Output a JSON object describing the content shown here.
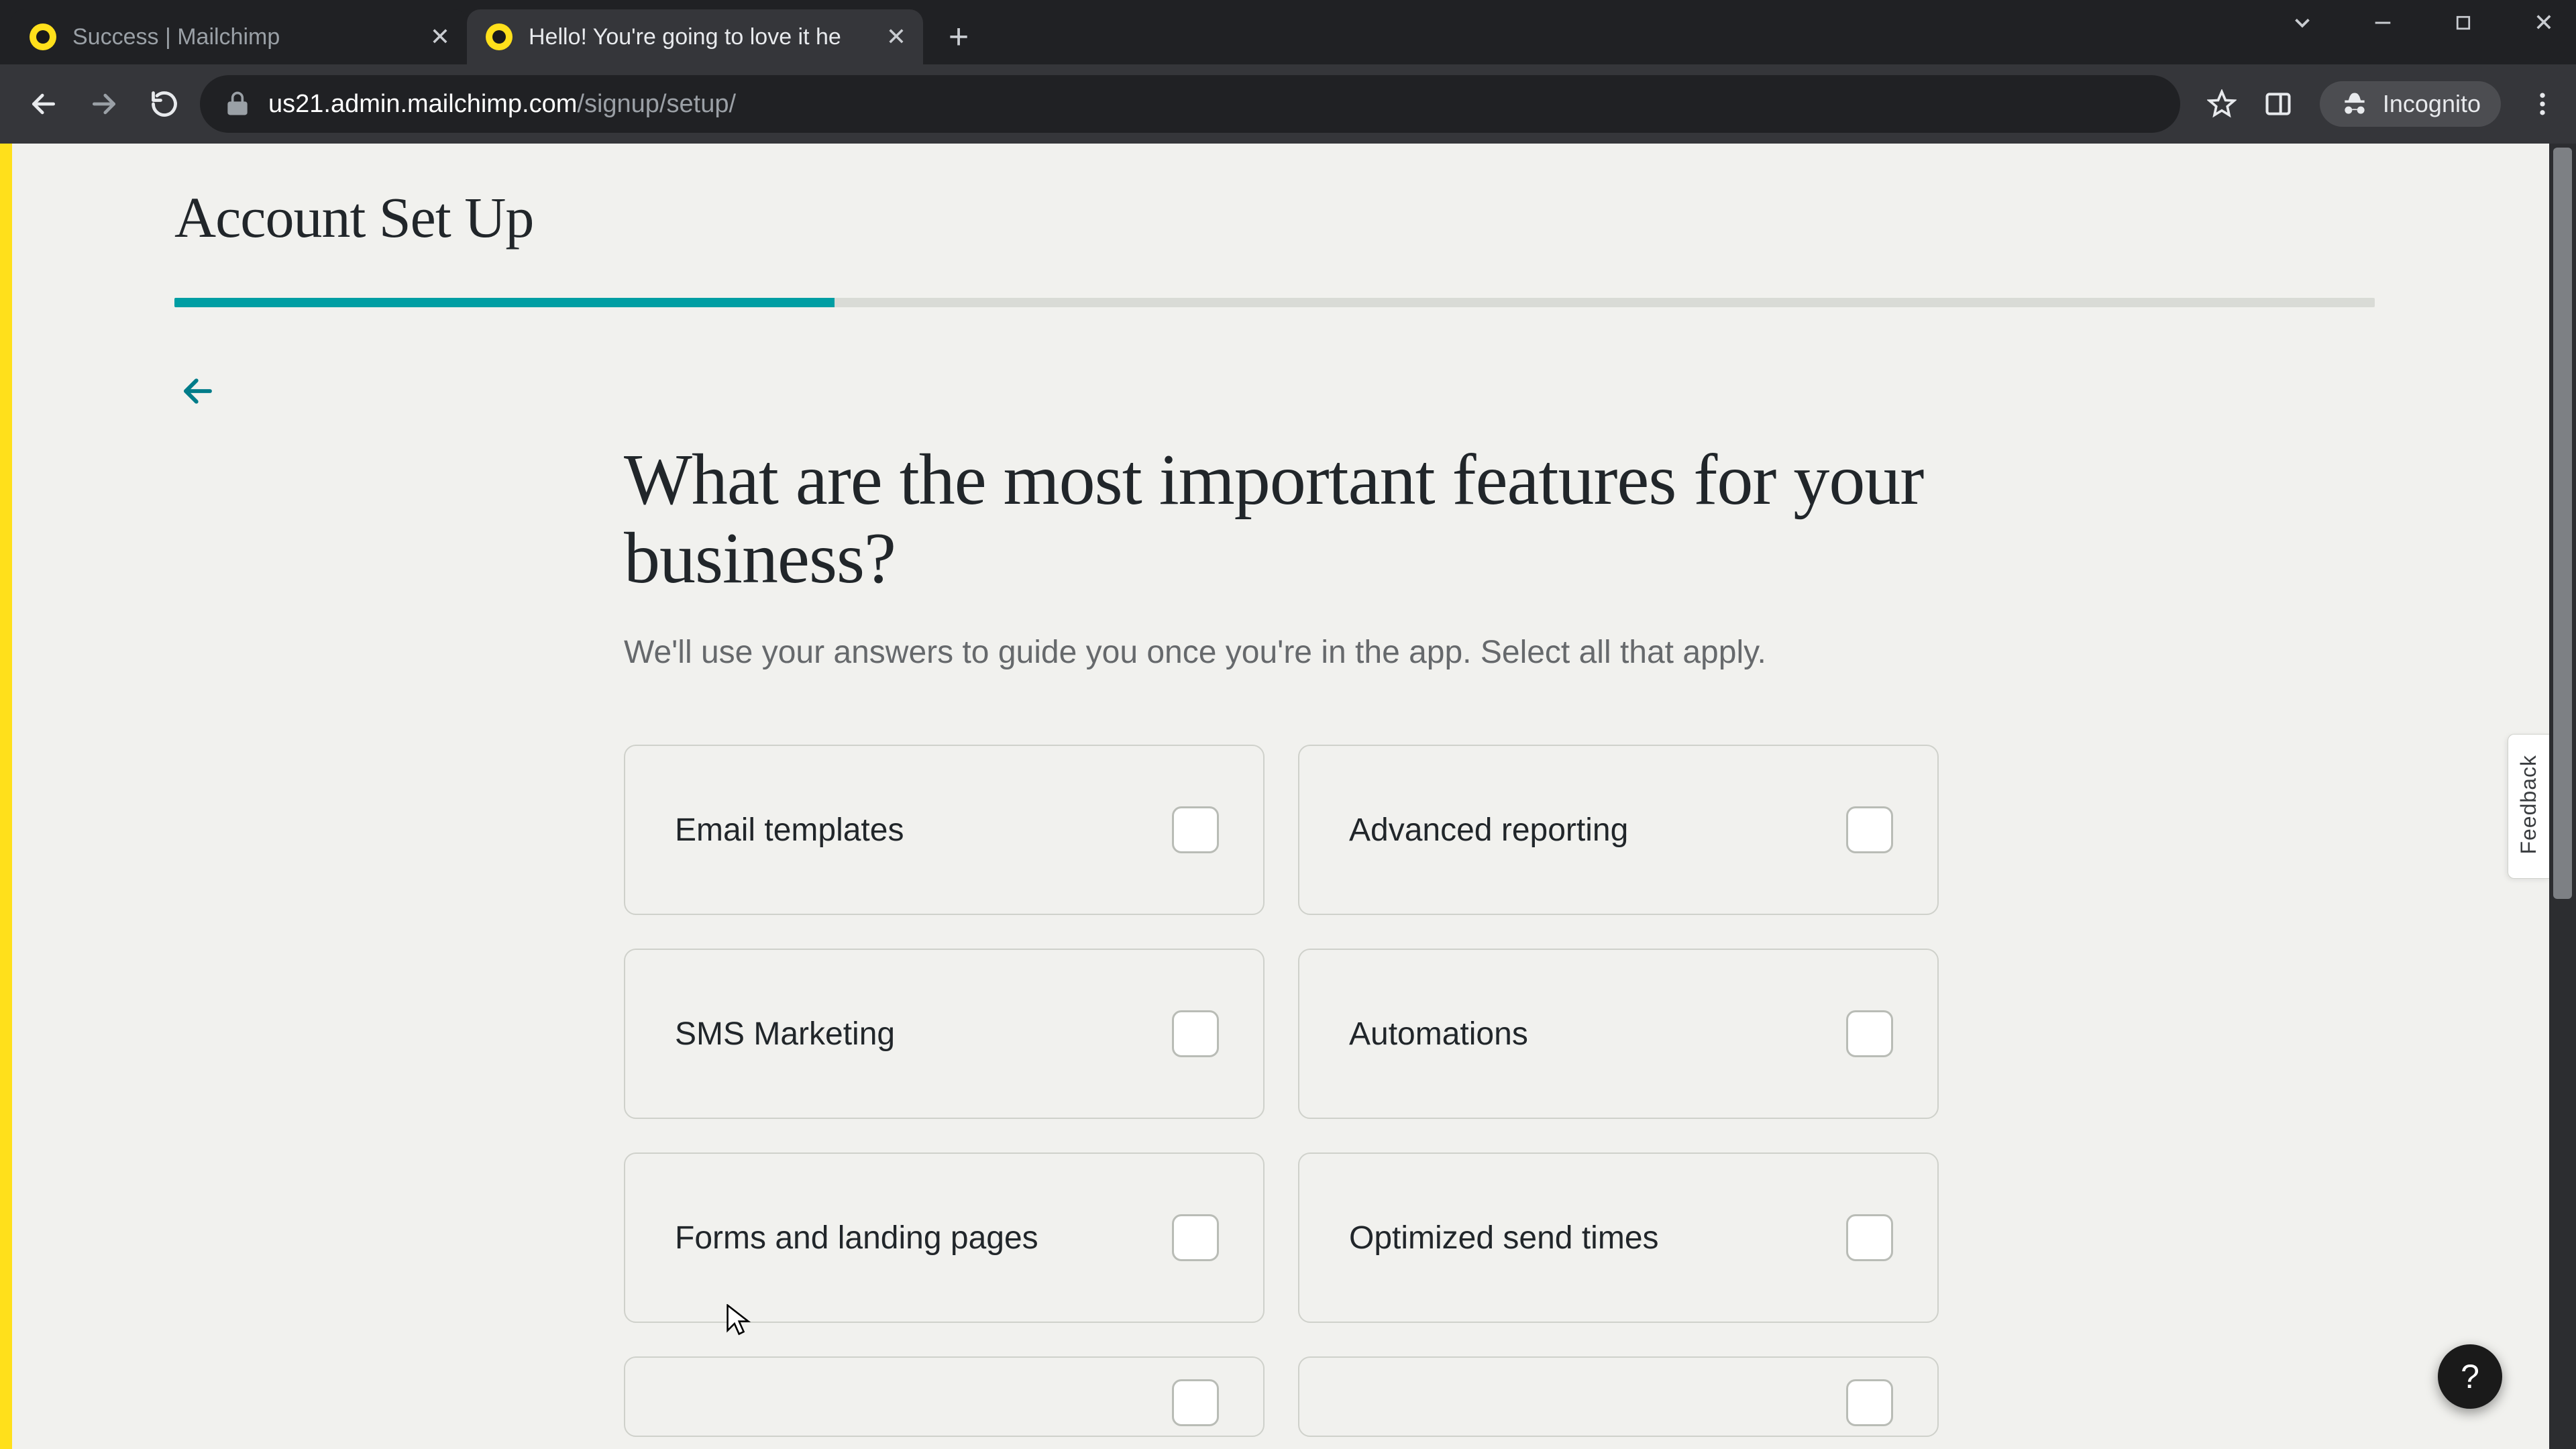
{
  "browser": {
    "tabs": [
      {
        "title": "Success | Mailchimp",
        "active": false
      },
      {
        "title": "Hello! You're going to love it he",
        "active": true
      }
    ],
    "url_host": "us21.admin.mailchimp.com",
    "url_path": "/signup/setup/",
    "incognito_label": "Incognito"
  },
  "page": {
    "title": "Account Set Up",
    "progress_percent": 30,
    "question": "What are the most important features for your business?",
    "subtext": "We'll use your answers to guide you once you're in the app. Select all that apply.",
    "options": [
      {
        "label": "Email templates"
      },
      {
        "label": "Advanced reporting"
      },
      {
        "label": "SMS Marketing"
      },
      {
        "label": "Automations"
      },
      {
        "label": "Forms and landing pages"
      },
      {
        "label": "Optimized send times"
      }
    ],
    "feedback_label": "Feedback",
    "help_label": "?"
  }
}
